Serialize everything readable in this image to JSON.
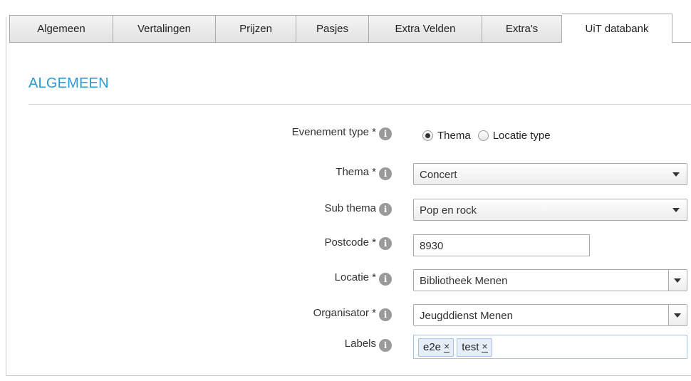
{
  "tabs": [
    {
      "label": "Algemeen",
      "active": false
    },
    {
      "label": "Vertalingen",
      "active": false
    },
    {
      "label": "Prijzen",
      "active": false
    },
    {
      "label": "Pasjes",
      "active": false
    },
    {
      "label": "Extra Velden",
      "active": false
    },
    {
      "label": "Extra's",
      "active": false
    },
    {
      "label": "UiT databank",
      "active": true
    }
  ],
  "section_title": "ALGEMEEN",
  "info_icon_glyph": "i",
  "colors": {
    "accent": "#2b9ad6"
  },
  "form": {
    "evenement_type": {
      "label": "Evenement type *",
      "options": [
        {
          "label": "Thema",
          "selected": true
        },
        {
          "label": "Locatie type",
          "selected": false
        }
      ]
    },
    "thema": {
      "label": "Thema *",
      "value": "Concert"
    },
    "sub_thema": {
      "label": "Sub thema",
      "value": "Pop en rock"
    },
    "postcode": {
      "label": "Postcode *",
      "value": "8930"
    },
    "locatie": {
      "label": "Locatie *",
      "value": "Bibliotheek Menen"
    },
    "organisator": {
      "label": "Organisator *",
      "value": "Jeugddienst Menen"
    },
    "labels": {
      "label": "Labels",
      "tags": [
        {
          "text": "e2e",
          "remove": "×"
        },
        {
          "text": "test",
          "remove": "×"
        }
      ]
    }
  }
}
